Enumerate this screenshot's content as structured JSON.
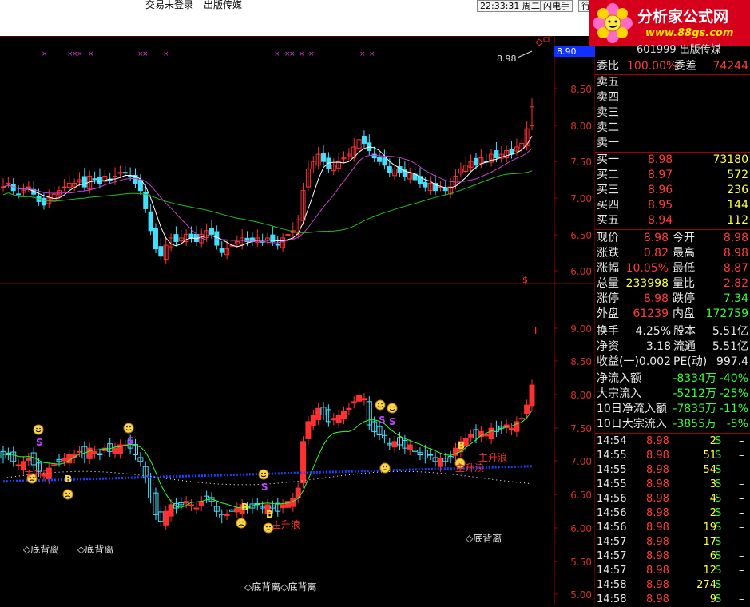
{
  "titlebar": {
    "status_text": "交易未登录",
    "stock_name": "出版传媒",
    "time": "22:33:31",
    "weekday": "周二",
    "btn_flash": "闪电手",
    "btn_market": "行"
  },
  "logo": {
    "name": "分析家公式网",
    "url": "www.88gs.com"
  },
  "header": {
    "code": "601999",
    "name": "出版传媒"
  },
  "top_chart": {
    "price_tag": "8.90",
    "last_label": "8.98",
    "axis_labels": [
      "8.50",
      "8.00",
      "7.50",
      "7.00",
      "6.50",
      "6.00"
    ],
    "cursor_mark": "$"
  },
  "bottom_chart": {
    "axis_labels": [
      "9.00",
      "8.50",
      "8.00",
      "7.50",
      "7.00",
      "6.50",
      "6.00",
      "5.50",
      "5.00"
    ],
    "top_mark": "T",
    "divergence_labels": [
      "◇底背离",
      "◇底背离",
      "◇底背离◇底背离",
      "◇底背离"
    ],
    "wave_labels": [
      "主升浪",
      "主升浪",
      "主升浪",
      "主升浪"
    ],
    "signal_s": "S",
    "signal_b": "B"
  },
  "quote": {
    "ratio_label": "委比",
    "ratio_value": "100.00%",
    "diff_label": "委差",
    "diff_value": "74244",
    "sell": [
      {
        "label": "卖五",
        "price": "",
        "vol": ""
      },
      {
        "label": "卖四",
        "price": "",
        "vol": ""
      },
      {
        "label": "卖三",
        "price": "",
        "vol": ""
      },
      {
        "label": "卖二",
        "price": "",
        "vol": ""
      },
      {
        "label": "卖一",
        "price": "",
        "vol": ""
      }
    ],
    "buy": [
      {
        "label": "买一",
        "price": "8.98",
        "vol": "73180"
      },
      {
        "label": "买二",
        "price": "8.97",
        "vol": "572"
      },
      {
        "label": "买三",
        "price": "8.96",
        "vol": "236"
      },
      {
        "label": "买四",
        "price": "8.95",
        "vol": "144"
      },
      {
        "label": "买五",
        "price": "8.94",
        "vol": "112"
      }
    ],
    "stats": [
      {
        "l1": "现价",
        "v1": "8.98",
        "c1": "red",
        "l2": "今开",
        "v2": "8.98",
        "c2": "red"
      },
      {
        "l1": "涨跌",
        "v1": "0.82",
        "c1": "red",
        "l2": "最高",
        "v2": "8.98",
        "c2": "red"
      },
      {
        "l1": "涨幅",
        "v1": "10.05%",
        "c1": "red",
        "l2": "最低",
        "v2": "8.87",
        "c2": "red"
      },
      {
        "l1": "总量",
        "v1": "233998",
        "c1": "yel",
        "l2": "量比",
        "v2": "2.82",
        "c2": "red"
      },
      {
        "l1": "涨停",
        "v1": "8.98",
        "c1": "red",
        "l2": "跌停",
        "v2": "7.34",
        "c2": "grn"
      },
      {
        "l1": "外盘",
        "v1": "61239",
        "c1": "red",
        "l2": "内盘",
        "v2": "172759",
        "c2": "grn"
      }
    ],
    "fund": [
      {
        "l1": "换手",
        "v1": "4.25%",
        "l2": "股本",
        "v2": "5.51亿"
      },
      {
        "l1": "净资",
        "v1": "3.18",
        "l2": "流通",
        "v2": "5.51亿"
      },
      {
        "l1": "收益(一)",
        "v1": "0.002",
        "l2": "PE(动)",
        "v2": "997.4"
      }
    ],
    "flow": [
      {
        "label": "净流入额",
        "val": "-8334万",
        "pct": "-40%"
      },
      {
        "label": "大宗流入",
        "val": "-5212万",
        "pct": "-25%"
      },
      {
        "label": "10日净流入额",
        "val": "-7835万",
        "pct": "-11%"
      },
      {
        "label": "10日大宗流入",
        "val": "-3855万",
        "pct": "-5%"
      }
    ],
    "ticks": [
      {
        "time": "14:54",
        "price": "8.98",
        "vol": "2",
        "side": "S"
      },
      {
        "time": "14:55",
        "price": "8.98",
        "vol": "51",
        "side": "S"
      },
      {
        "time": "14:55",
        "price": "8.98",
        "vol": "54",
        "side": "S"
      },
      {
        "time": "14:55",
        "price": "8.98",
        "vol": "3",
        "side": "S"
      },
      {
        "time": "14:56",
        "price": "8.98",
        "vol": "4",
        "side": "S"
      },
      {
        "time": "14:56",
        "price": "8.98",
        "vol": "2",
        "side": "S"
      },
      {
        "time": "14:56",
        "price": "8.98",
        "vol": "19",
        "side": "S"
      },
      {
        "time": "14:57",
        "price": "8.98",
        "vol": "17",
        "side": "S"
      },
      {
        "time": "14:57",
        "price": "8.98",
        "vol": "6",
        "side": "S"
      },
      {
        "time": "14:57",
        "price": "8.98",
        "vol": "12",
        "side": "S"
      },
      {
        "time": "14:58",
        "price": "8.98",
        "vol": "274",
        "side": "S"
      },
      {
        "time": "14:58",
        "price": "8.98",
        "vol": "9",
        "side": "S"
      }
    ]
  },
  "colors": {
    "up": "#ff3030",
    "down": "#40e0ff",
    "ma_white": "#ffffff",
    "ma_magenta": "#d040d0",
    "ma_green": "#20c020",
    "grid_red": "#a00000"
  }
}
